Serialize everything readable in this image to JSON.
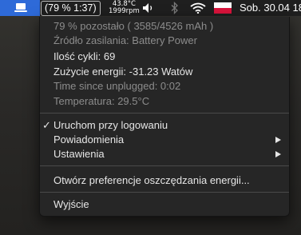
{
  "menubar": {
    "app_icon": "laptop-battery-icon",
    "battery_status": "(79 % 1:37)",
    "cpu_temp": "43.8°C",
    "fan_rpm": "1999rpm",
    "clock": "Sob. 30.04  18 3",
    "icons": [
      "volume-icon",
      "bluetooth-icon",
      "wifi-icon",
      "flag-icon"
    ]
  },
  "info": {
    "remaining": "79 % pozostało ( 3585/4526 mAh )",
    "source": "Źródło zasilania: Battery Power",
    "cycles": "Ilość cykli: 69",
    "power": "Zużycie energii: -31.23 Watów",
    "since_unplugged": "Time since unplugged: 0:02",
    "temperature": "Temperatura: 29.5°C"
  },
  "menu": {
    "launch_at_login": "Uruchom przy logowaniu",
    "launch_checked": true,
    "notifications": "Powiadomienia",
    "settings": "Ustawienia",
    "open_prefs": "Otwórz preferencje oszczędzania energii...",
    "quit": "Wyjście",
    "check_mark": "✓"
  },
  "colors": {
    "menubar_bg": "#1f1f1f",
    "menu_bg": "#262626",
    "app_icon_bg": "#2e6ad8",
    "dim_text": "#8c8c8c",
    "bright_text": "#e6e6e6"
  }
}
